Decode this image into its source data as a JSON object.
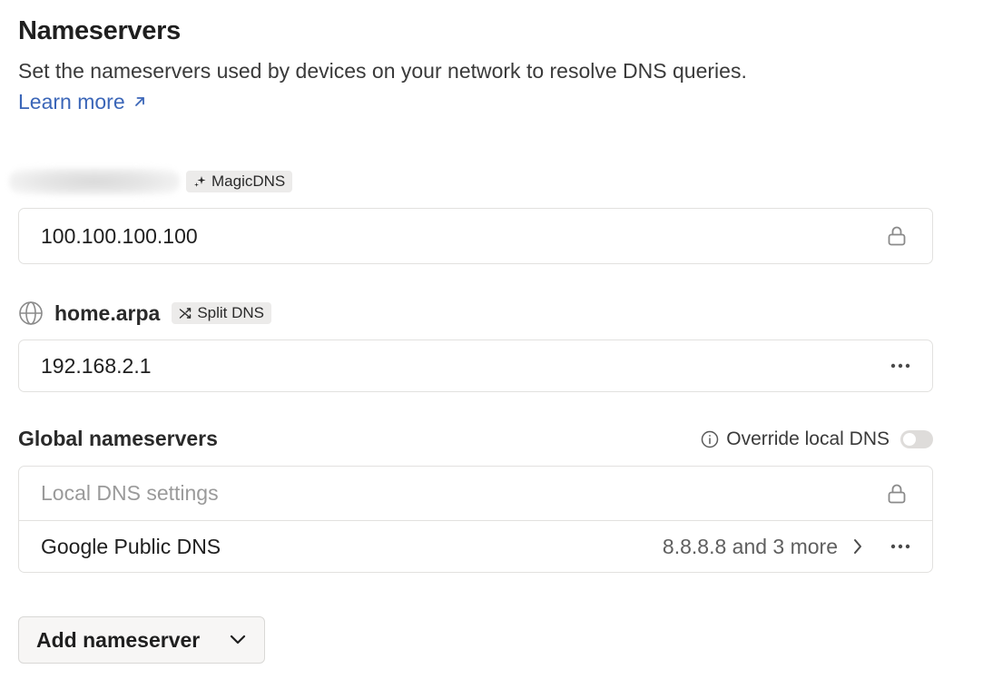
{
  "header": {
    "title": "Nameservers",
    "description": "Set the nameservers used by devices on your network to resolve DNS queries.",
    "learn_more": "Learn more"
  },
  "magic_dns": {
    "tag_label": "MagicDNS",
    "tag_icon": "sparkle-icon",
    "address": "100.100.100.100",
    "row_icon": "lock-icon"
  },
  "split_dns": {
    "domain": "home.arpa",
    "tag_label": "Split DNS",
    "tag_icon": "shuffle-icon",
    "address": "192.168.2.1",
    "row_icon": "more-dots-icon"
  },
  "global": {
    "title": "Global nameservers",
    "override_label": "Override local DNS",
    "override_enabled": false,
    "rows": [
      {
        "name": "Local DNS settings",
        "icon": "lock-icon"
      },
      {
        "name": "Google Public DNS",
        "summary": "8.8.8.8 and 3 more",
        "icon": "more-dots-icon"
      }
    ]
  },
  "add_button": {
    "label": "Add nameserver"
  },
  "colors": {
    "link": "#3b66b8",
    "tag_bg": "#ecebea",
    "border": "#e2e1df",
    "muted_text": "#9a9a9a"
  }
}
